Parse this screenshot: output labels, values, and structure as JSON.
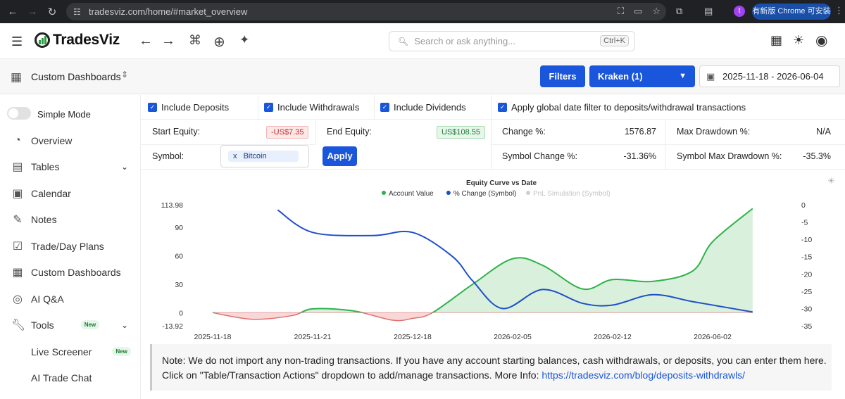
{
  "browser": {
    "url": "tradesviz.com/home/#market_overview",
    "update_chip": "有新版 Chrome 可安装",
    "profile_initial": "t"
  },
  "header": {
    "brand": "TradesViz",
    "search_placeholder": "Search or ask anything...",
    "search_shortcut": "Ctrl+K"
  },
  "subheader": {
    "dashboard_title": "Custom Dashboards",
    "filters_label": "Filters",
    "account_select": "Kraken (1)",
    "date_range": "2025-11-18 - 2026-06-04"
  },
  "sidebar": {
    "simple_mode_label": "Simple Mode",
    "items": [
      {
        "label": "Overview",
        "icon": "pie-chart-icon"
      },
      {
        "label": "Tables",
        "icon": "table-icon"
      },
      {
        "label": "Calendar",
        "icon": "calendar-icon"
      },
      {
        "label": "Notes",
        "icon": "pen-icon"
      },
      {
        "label": "Trade/Day Plans",
        "icon": "clipboard-icon"
      },
      {
        "label": "Custom Dashboards",
        "icon": "grid-icon"
      },
      {
        "label": "AI Q&A",
        "icon": "brain-icon"
      },
      {
        "label": "Tools",
        "icon": "wrench-icon",
        "badge": "New"
      },
      {
        "label": "Live Screener",
        "badge": "New"
      },
      {
        "label": "AI Trade Chat"
      }
    ]
  },
  "filters": {
    "include_deposits": "Include Deposits",
    "include_withdrawals": "Include Withdrawals",
    "include_dividends": "Include Dividends",
    "apply_global_date": "Apply global date filter to deposits/withdrawal transactions",
    "start_equity_label": "Start Equity:",
    "start_equity_value": "-US$7.35",
    "end_equity_label": "End Equity:",
    "end_equity_value": "US$108.55",
    "change_label": "Change %:",
    "change_value": "1576.87",
    "max_drawdown_label": "Max Drawdown %:",
    "max_drawdown_value": "N/A",
    "symbol_label": "Symbol:",
    "symbol_tag_remove": "x",
    "symbol_tag": "Bitcoin",
    "apply_label": "Apply",
    "symbol_change_label": "Symbol Change %:",
    "symbol_change_value": "-31.36%",
    "symbol_max_dd_label": "Symbol Max Drawdown %:",
    "symbol_max_dd_value": "-35.3%"
  },
  "chart_data": {
    "type": "line",
    "title": "Equity Curve vs Date",
    "legend": [
      "Account Value",
      "% Change (Symbol)",
      "PnL Simulation (Symbol)"
    ],
    "legend_position": "top-center",
    "x_ticks": [
      "2025-11-18",
      "2025-11-21",
      "2025-12-18",
      "2026-02-05",
      "2026-02-12",
      "2026-06-02"
    ],
    "y_left_ticks": [
      "113.98",
      "90",
      "60",
      "30",
      "0",
      "-13.92"
    ],
    "y_left_range": [
      -13.92,
      113.98
    ],
    "y_right_ticks": [
      "0",
      "-5",
      "-10",
      "-15",
      "-20",
      "-25",
      "-30",
      "-35"
    ],
    "y_right_range": [
      -35,
      0
    ],
    "series": [
      {
        "name": "Account Value",
        "color": "#2fb34a",
        "x": [
          0,
          0.4,
          0.8,
          1.0,
          1.4,
          1.8,
          2.0,
          2.2,
          2.6,
          3.0,
          3.3,
          3.7,
          4.0,
          4.4,
          4.8,
          5.0,
          5.4
        ],
        "y": [
          0,
          -7,
          -3,
          4,
          2,
          -8,
          -6,
          0,
          30,
          57,
          50,
          25,
          35,
          33,
          44,
          75,
          110
        ]
      },
      {
        "name": "% Change (Symbol)",
        "color": "#1e4fc8",
        "x": [
          0.65,
          1.0,
          1.6,
          2.0,
          2.4,
          2.6,
          2.9,
          3.3,
          3.7,
          4.0,
          4.4,
          4.8,
          5.2,
          5.4
        ],
        "y": [
          -1.5,
          -8,
          -8.9,
          -8,
          -15,
          -22,
          -30,
          -24.5,
          -28.5,
          -29,
          -26,
          -28,
          -30,
          -31
        ]
      },
      {
        "name": "PnL Simulation (Symbol)",
        "color": "#cfcfcf",
        "hidden": true,
        "x": [],
        "y": []
      }
    ]
  },
  "note": {
    "text": "Note: We do not import any non-trading transactions. If you have any account starting balances, cash withdrawals, or deposits, you can enter them here. Click on \"Table/Transaction Actions\" dropdown to add/manage transactions. More Info: ",
    "link": "https://tradesviz.com/blog/deposits-withdrawls/"
  }
}
